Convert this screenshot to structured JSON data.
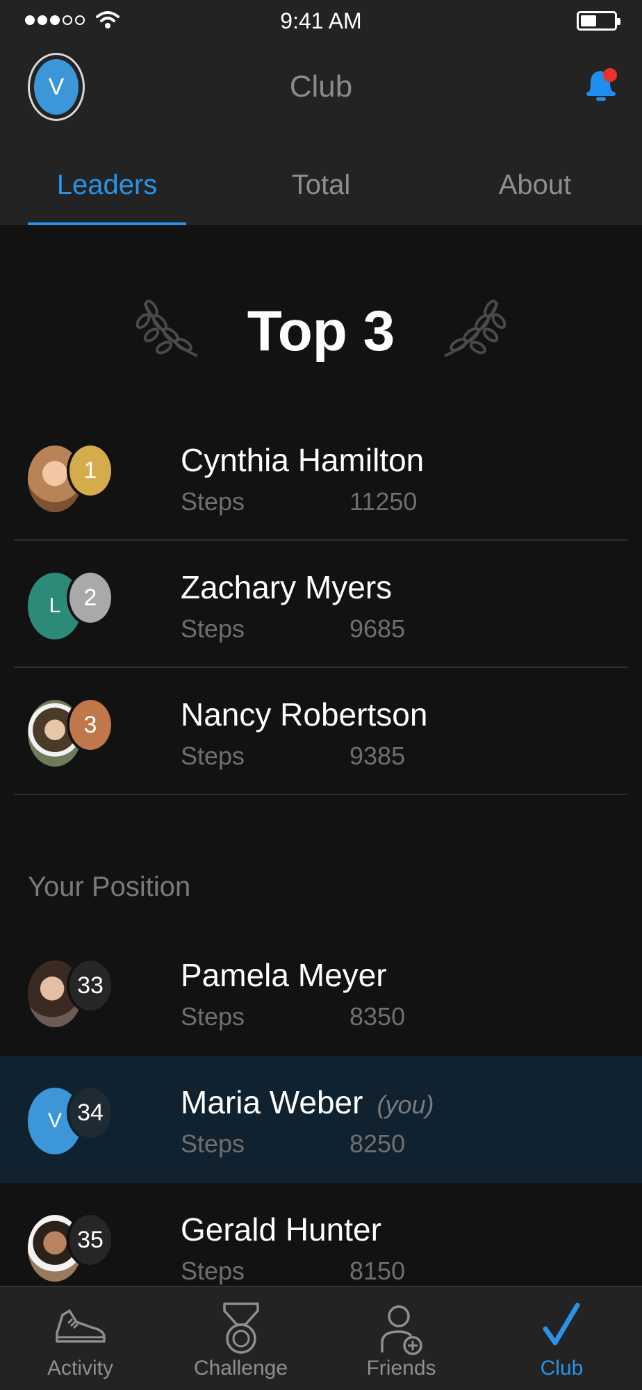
{
  "status_bar": {
    "time": "9:41 AM"
  },
  "header": {
    "avatar_letter": "V",
    "title": "Club",
    "bell_color": "#1e8ef0",
    "badge_color": "#e8322b"
  },
  "tabs": [
    {
      "label": "Leaders",
      "active": true
    },
    {
      "label": "Total",
      "active": false
    },
    {
      "label": "About",
      "active": false
    }
  ],
  "top3": {
    "title": "Top 3",
    "rows": [
      {
        "rank": "1",
        "name": "Cynthia Hamilton",
        "metric": "Steps",
        "value": "11250",
        "rank_color": "#d5ac4b",
        "avatar": "photo"
      },
      {
        "rank": "2",
        "name": "Zachary Myers",
        "metric": "Steps",
        "value": "9685",
        "rank_color": "#a9a9a9",
        "avatar_letter": "L",
        "avatar_color": "#2e8a78"
      },
      {
        "rank": "3",
        "name": "Nancy Robertson",
        "metric": "Steps",
        "value": "9385",
        "rank_color": "#c0784a",
        "avatar": "photo"
      }
    ]
  },
  "your_position": {
    "label": "Your Position",
    "rows": [
      {
        "rank": "33",
        "name": "Pamela Meyer",
        "metric": "Steps",
        "value": "8350",
        "avatar": "photo"
      },
      {
        "rank": "34",
        "name": "Maria Weber",
        "you_tag": "(you)",
        "metric": "Steps",
        "value": "8250",
        "avatar_letter": "V",
        "avatar_color": "#3c96d8",
        "highlight": true
      },
      {
        "rank": "35",
        "name": "Gerald Hunter",
        "metric": "Steps",
        "value": "8150",
        "avatar": "photo"
      }
    ]
  },
  "bottom_nav": [
    {
      "label": "Activity",
      "icon": "sneaker-icon",
      "active": false
    },
    {
      "label": "Challenge",
      "icon": "medal-icon",
      "active": false
    },
    {
      "label": "Friends",
      "icon": "add-friend-icon",
      "active": false
    },
    {
      "label": "Club",
      "icon": "checkmark-icon",
      "active": true
    }
  ],
  "colors": {
    "accent": "#2a93e8",
    "background": "#121212",
    "header_background": "#232323",
    "highlight_row": "#10222f"
  }
}
